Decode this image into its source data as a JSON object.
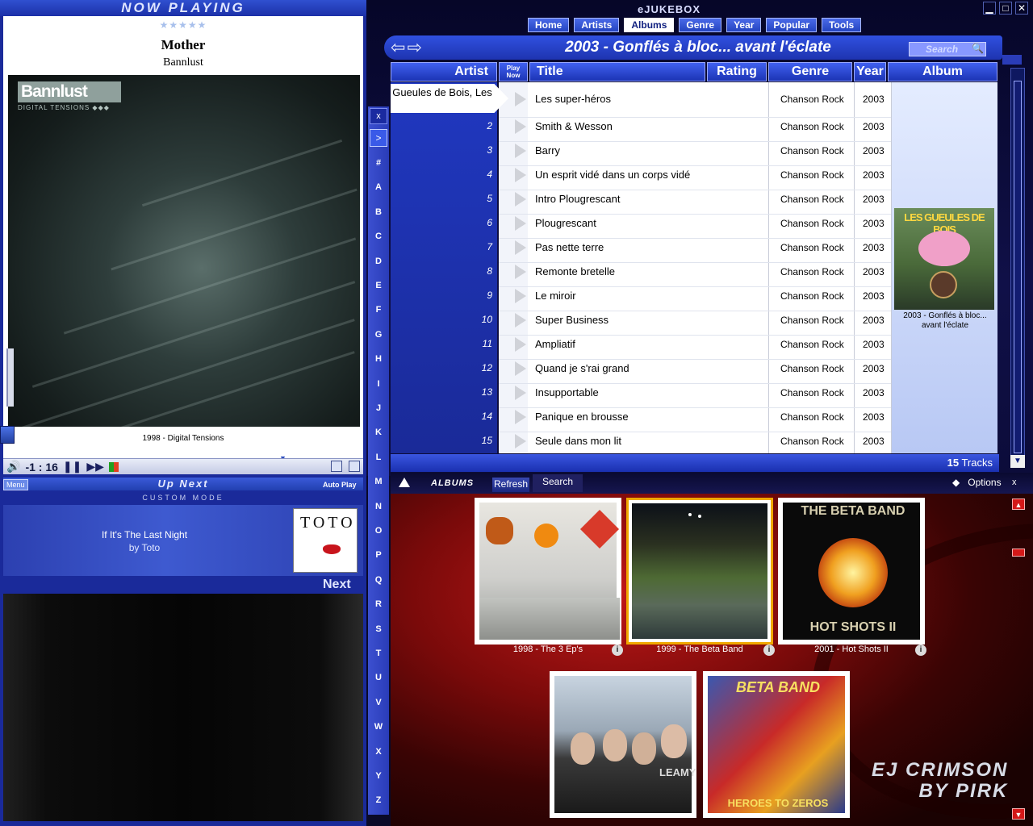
{
  "now_playing": {
    "header": "NOW PLAYING",
    "stars": "★★★★★",
    "title": "Mother",
    "artist": "Bannlust",
    "art_logo": "Bannlust",
    "art_logo_sub": "DIGITAL TENSIONS  ◆◆◆",
    "album": "1998 - Digital Tensions",
    "time": "-1 : 16",
    "volume_icon": "🔊",
    "pause_icon": "❚❚",
    "next_icon": "▶▶"
  },
  "up_next": {
    "menu": "Menu",
    "title": "Up Next",
    "auto_play": "Auto Play",
    "mode": "CUSTOM MODE",
    "song": "If It's The Last Night",
    "by": "by Toto",
    "art_word": "TOTO",
    "next_label": "Next"
  },
  "alphabet": [
    "#",
    "A",
    "B",
    "C",
    "D",
    "E",
    "F",
    "G",
    "H",
    "I",
    "J",
    "K",
    "L",
    "M",
    "N",
    "O",
    "P",
    "Q",
    "R",
    "S",
    "T",
    "U",
    "V",
    "W",
    "X",
    "Y",
    "Z"
  ],
  "alpha_close": "x",
  "alpha_expand": ">",
  "app": {
    "title": "eJUKEBOX",
    "min": "▁",
    "max": "□",
    "close": "✕"
  },
  "tabs": [
    {
      "label": "Home",
      "active": false
    },
    {
      "label": "Artists",
      "active": false
    },
    {
      "label": "Albums",
      "active": true
    },
    {
      "label": "Genre",
      "active": false
    },
    {
      "label": "Year",
      "active": false
    },
    {
      "label": "Popular",
      "active": false
    },
    {
      "label": "Tools",
      "active": false
    }
  ],
  "nav": {
    "back": "⇦",
    "forward": "⇨"
  },
  "album_header": {
    "title": "2003 - Gonflés à bloc... avant l'éclate",
    "search_placeholder": "Search"
  },
  "columns": {
    "artist": "Artist",
    "play_now": "Play Now",
    "title": "Title",
    "rating": "Rating",
    "genre": "Genre",
    "year": "Year",
    "album": "Album"
  },
  "artist_name": "Gueules de Bois, Les",
  "tracks": [
    {
      "n": "",
      "title": "Les super-héros",
      "genre": "Chanson Rock",
      "year": "2003"
    },
    {
      "n": "2",
      "title": "Smith & Wesson",
      "genre": "Chanson Rock",
      "year": "2003"
    },
    {
      "n": "3",
      "title": "Barry",
      "genre": "Chanson Rock",
      "year": "2003"
    },
    {
      "n": "4",
      "title": "Un esprit vidé dans un corps vidé",
      "genre": "Chanson Rock",
      "year": "2003"
    },
    {
      "n": "5",
      "title": "Intro Plougrescant",
      "genre": "Chanson Rock",
      "year": "2003"
    },
    {
      "n": "6",
      "title": "Plougrescant",
      "genre": "Chanson Rock",
      "year": "2003"
    },
    {
      "n": "7",
      "title": "Pas nette terre",
      "genre": "Chanson Rock",
      "year": "2003"
    },
    {
      "n": "8",
      "title": "Remonte bretelle",
      "genre": "Chanson Rock",
      "year": "2003"
    },
    {
      "n": "9",
      "title": "Le miroir",
      "genre": "Chanson Rock",
      "year": "2003"
    },
    {
      "n": "10",
      "title": "Super Business",
      "genre": "Chanson Rock",
      "year": "2003"
    },
    {
      "n": "11",
      "title": "Ampliatif",
      "genre": "Chanson Rock",
      "year": "2003"
    },
    {
      "n": "12",
      "title": "Quand je s'rai grand",
      "genre": "Chanson Rock",
      "year": "2003"
    },
    {
      "n": "13",
      "title": "Insupportable",
      "genre": "Chanson Rock",
      "year": "2003"
    },
    {
      "n": "14",
      "title": "Panique en brousse",
      "genre": "Chanson Rock",
      "year": "2003"
    },
    {
      "n": "15",
      "title": "Seule dans mon lit",
      "genre": "Chanson Rock",
      "year": "2003"
    }
  ],
  "album_cover": {
    "art_text": "LES GUEULES DE BOIS",
    "caption": "2003 - Gonflés à bloc... avant l'éclate"
  },
  "track_count": "15",
  "track_count_label": "Tracks",
  "scroll_down": "▼",
  "browser_bar": {
    "albums": "ALBUMS",
    "refresh": "Refresh",
    "search": "Search",
    "options_icon": "◆",
    "options": "Options",
    "close": "x"
  },
  "albums": [
    {
      "caption": "1998 - The 3 Ep's",
      "selected": false
    },
    {
      "caption": "1999 - The Beta Band",
      "selected": true
    },
    {
      "caption": "2001 - Hot Shots II",
      "art_text": "THE BETA BAND",
      "art_sub": "HOT SHOTS II",
      "selected": false
    },
    {
      "caption": "",
      "art_text": "LEAMY",
      "selected": false
    },
    {
      "caption": "",
      "art_text": "BETA BAND",
      "art_sub": "HEROES TO ZEROS",
      "selected": false
    }
  ],
  "album_info_icon": "i",
  "brand": {
    "line1": "EJ CRIMSON",
    "line2": "BY PIRK"
  },
  "colors": {
    "accent": "#2444c0",
    "selected": "#f0a800",
    "browser_bg": "#7a0a0a"
  }
}
